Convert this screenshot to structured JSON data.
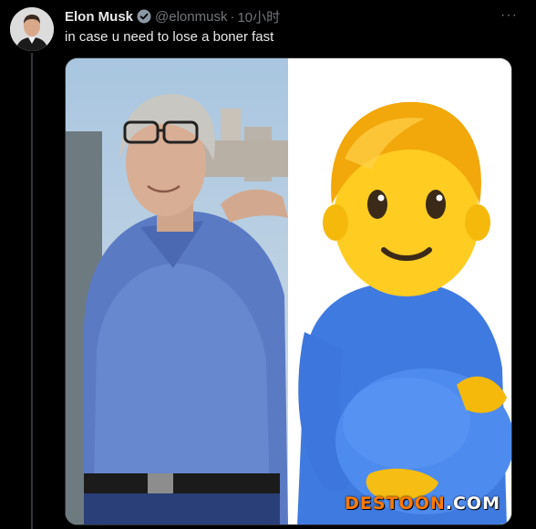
{
  "author": {
    "name": "Elon Musk",
    "handle": "@elonmusk",
    "separator": "·",
    "time": "10小时",
    "verified": true
  },
  "menu": {
    "label": "···"
  },
  "tweet": {
    "text": "in case u need to lose a boner fast"
  },
  "media": {
    "left_image": "photo of man in blue polo shirt",
    "right_image": "pregnant man emoji"
  },
  "watermark": {
    "main": "DESTOON",
    "tld": ".COM"
  },
  "colors": {
    "background": "#000000",
    "text_primary": "#e7e9ea",
    "text_secondary": "#71767b",
    "verified": "#8b98a5",
    "watermark": "#ff7a00"
  }
}
